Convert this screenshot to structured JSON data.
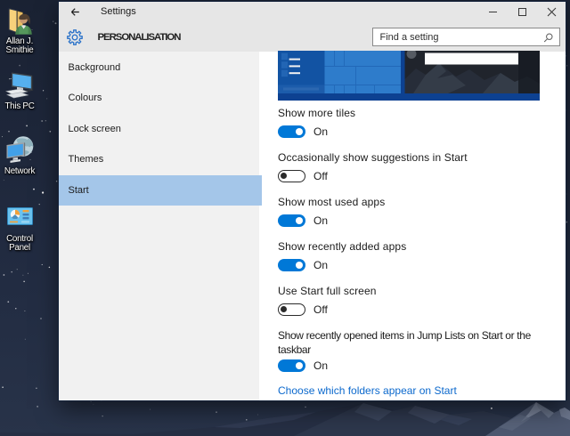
{
  "desktop": {
    "icons": [
      {
        "id": "user-folder",
        "label_lines": [
          "Allan J.",
          "Smithie"
        ]
      },
      {
        "id": "this-pc",
        "label_lines": [
          "This PC"
        ]
      },
      {
        "id": "network",
        "label_lines": [
          "Network"
        ]
      },
      {
        "id": "control-panel",
        "label_lines": [
          "Control",
          "Panel"
        ]
      }
    ]
  },
  "titlebar": {
    "title": "Settings"
  },
  "header": {
    "page_title": "PERSONALISATION"
  },
  "search": {
    "placeholder": "Find a setting"
  },
  "nav": {
    "items": [
      {
        "label": "Background",
        "selected": false
      },
      {
        "label": "Colours",
        "selected": false
      },
      {
        "label": "Lock screen",
        "selected": false
      },
      {
        "label": "Themes",
        "selected": false
      },
      {
        "label": "Start",
        "selected": true
      }
    ]
  },
  "settings": {
    "rows": [
      {
        "label": "Show more tiles",
        "state": "On"
      },
      {
        "label": "Occasionally show suggestions in Start",
        "state": "Off"
      },
      {
        "label": "Show most used apps",
        "state": "On"
      },
      {
        "label": "Show recently added apps",
        "state": "On"
      },
      {
        "label": "Use Start full screen",
        "state": "Off"
      },
      {
        "label": "Show recently opened items in Jump Lists on Start or the taskbar",
        "state": "On"
      }
    ],
    "link": "Choose which folders appear on Start"
  },
  "colors": {
    "accent": "#0078d7",
    "nav_highlight": "#a4c6e9",
    "titlebar_bg": "#e6e6e6",
    "link": "#0c69cd"
  }
}
